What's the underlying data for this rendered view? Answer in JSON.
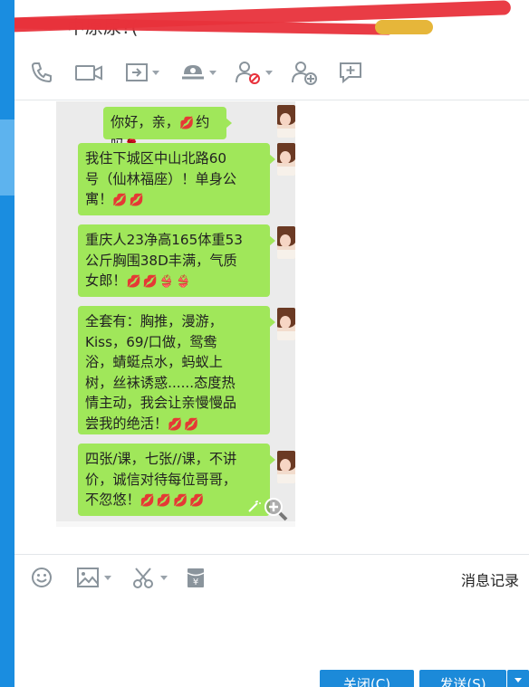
{
  "window": {
    "title": "中原尿?(",
    "colors": {
      "sidebar": "#1a8de0",
      "bubble": "#a0e75a",
      "button": "#1c8ad9"
    }
  },
  "toolbar": {
    "items": [
      {
        "icon": "phone-icon"
      },
      {
        "icon": "video-icon"
      },
      {
        "icon": "share-screen-icon",
        "has_dropdown": true
      },
      {
        "icon": "remote-assist-icon",
        "has_dropdown": true
      },
      {
        "icon": "block-user-icon",
        "has_dropdown": true
      },
      {
        "icon": "add-user-icon"
      },
      {
        "icon": "message-board-icon"
      }
    ]
  },
  "chat": {
    "messages": [
      {
        "text": "你好，亲，",
        "tail": "约吗",
        "emojis": "👄 🌹"
      },
      {
        "text": "我住下城区中山北路60\n号（仙林福座）！单身公\n寓！",
        "emojis": "💋💋"
      },
      {
        "text": "重庆人23净高165体重53\n公斤胸围38D丰满，气质\n女郎！",
        "emojis": "💋💋👙👙"
      },
      {
        "text": "全套有：胸推，漫游，\nKiss，69/口做，鸳鸯\n浴，蜻蜓点水，蚂蚁上\n树，丝袜诱惑......态度热\n情主动，我会让亲慢慢品\n尝我的绝活！",
        "emojis": "💋💋"
      },
      {
        "text": "四张/课，七张//课，不讲\n价，诚信对待每位哥哥，\n不忽悠！",
        "emojis": "💋💋💋💋"
      }
    ]
  },
  "input_toolbar": {
    "items": [
      {
        "icon": "emoji-icon"
      },
      {
        "icon": "image-icon",
        "has_dropdown": true
      },
      {
        "icon": "scissors-icon",
        "has_dropdown": true
      },
      {
        "icon": "red-packet-icon"
      }
    ],
    "history_label": "消息记录"
  },
  "buttons": {
    "close_label": "关闭(C)",
    "send_label": "发送(S)"
  }
}
